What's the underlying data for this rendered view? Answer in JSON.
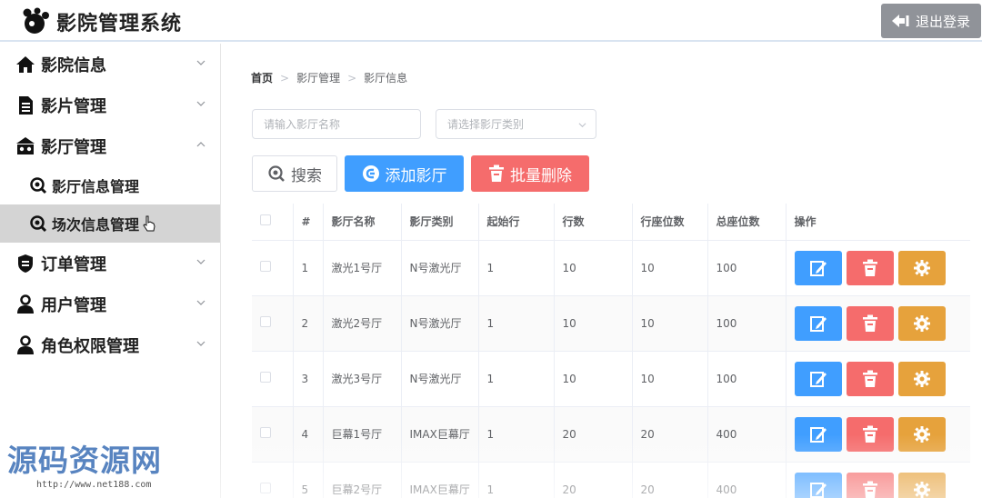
{
  "header": {
    "title": "影院管理系统",
    "logout_label": "退出登录"
  },
  "sidebar": {
    "items": [
      {
        "label": "影院信息",
        "icon": "home-icon",
        "expanded": false
      },
      {
        "label": "影片管理",
        "icon": "document-icon",
        "expanded": false
      },
      {
        "label": "影厅管理",
        "icon": "theater-icon",
        "expanded": true,
        "children": [
          {
            "label": "影厅信息管理",
            "icon": "search-icon",
            "active": false
          },
          {
            "label": "场次信息管理",
            "icon": "search-icon",
            "active": true
          }
        ]
      },
      {
        "label": "订单管理",
        "icon": "shield-icon",
        "expanded": false
      },
      {
        "label": "用户管理",
        "icon": "user-icon",
        "expanded": false
      },
      {
        "label": "角色权限管理",
        "icon": "user-icon",
        "expanded": false
      }
    ]
  },
  "breadcrumb": {
    "home": "首页",
    "level1": "影厅管理",
    "level2": "影厅信息"
  },
  "filters": {
    "name_placeholder": "请输入影厅名称",
    "type_placeholder": "请选择影厅类别"
  },
  "toolbar": {
    "search_label": "搜索",
    "add_label": "添加影厅",
    "batch_delete_label": "批量删除"
  },
  "table": {
    "columns": [
      "#",
      "影厅名称",
      "影厅类别",
      "起始行",
      "行数",
      "行座位数",
      "总座位数",
      "操作"
    ],
    "rows": [
      {
        "index": "1",
        "name": "激光1号厅",
        "type": "N号激光厅",
        "start_row": "1",
        "rows": "10",
        "seats_per_row": "10",
        "total_seats": "100"
      },
      {
        "index": "2",
        "name": "激光2号厅",
        "type": "N号激光厅",
        "start_row": "1",
        "rows": "10",
        "seats_per_row": "10",
        "total_seats": "100"
      },
      {
        "index": "3",
        "name": "激光3号厅",
        "type": "N号激光厅",
        "start_row": "1",
        "rows": "10",
        "seats_per_row": "10",
        "total_seats": "100"
      },
      {
        "index": "4",
        "name": "巨幕1号厅",
        "type": "IMAX巨幕厅",
        "start_row": "1",
        "rows": "20",
        "seats_per_row": "20",
        "total_seats": "400"
      },
      {
        "index": "5",
        "name": "巨幕2号厅",
        "type": "IMAX巨幕厅",
        "start_row": "1",
        "rows": "20",
        "seats_per_row": "20",
        "total_seats": "400"
      }
    ]
  },
  "watermark": {
    "text": "源码资源网",
    "url": "http://www.net188.com"
  },
  "colors": {
    "primary": "#409eff",
    "danger": "#f56c6c",
    "warning": "#e6a23c",
    "logout_bg": "#909399"
  }
}
